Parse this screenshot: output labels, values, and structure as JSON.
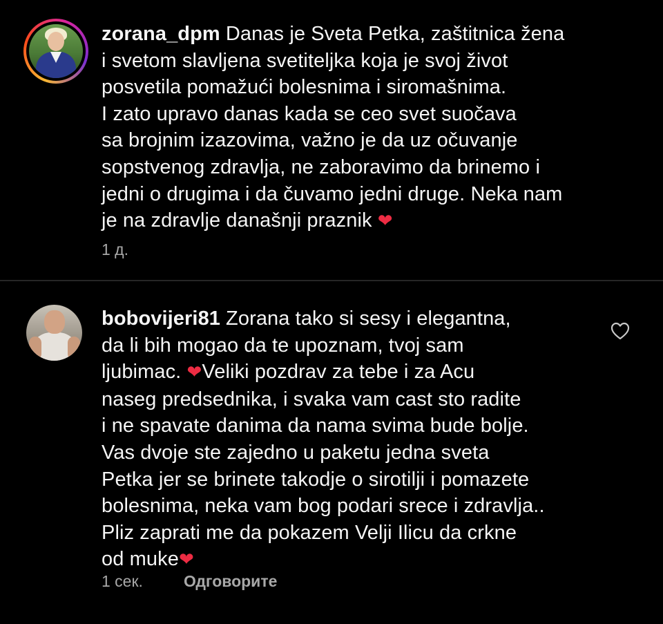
{
  "comments": [
    {
      "username": "zorana_dpm",
      "lines": [
        "Danas je Sveta Petka, zaštitnica žena",
        "i svetom slavljena svetiteljka koja je svoj život",
        "posvetila pomažući bolesnima i siromašnima.",
        "I zato upravo danas kada se ceo svet suočava",
        "sa brojnim izazovima, važno je da uz očuvanje",
        "sopstvenog zdravlja, ne zaboravimo da brinemo i",
        "jedni o drugima i da čuvamo jedni druge. Neka nam",
        "je na zdravlje današnji praznik"
      ],
      "heart": "❤",
      "time": "1 д."
    },
    {
      "username": "bobovijeri81",
      "lines": [
        "Zorana tako si sesy i elegantna,",
        "da li bih mogao da te upoznam, tvoj sam",
        "ljubimac.",
        "Veliki pozdrav za tebe i za Acu",
        "naseg predsednika, i svaka vam cast sto radite",
        "i ne spavate danima da nama svima bude bolje.",
        "Vas dvoje ste zajedno u paketu jedna sveta",
        "Petka jer se brinete takodje o sirotilji i  pomazete",
        "bolesnima, neka vam bog podari srece i zdravlja..",
        "Pliz zaprati me da pokazem Velji Ilicu da crkne",
        "od muke"
      ],
      "heart": "❤",
      "time": "1 сек.",
      "reply_label": "Одговорите",
      "like_icon": "heart-outline-icon"
    }
  ],
  "colors": {
    "background": "#000000",
    "text": "#f5f5f5",
    "meta": "#a8a8a8",
    "heart": "#ed2c43",
    "divider": "#262626"
  }
}
